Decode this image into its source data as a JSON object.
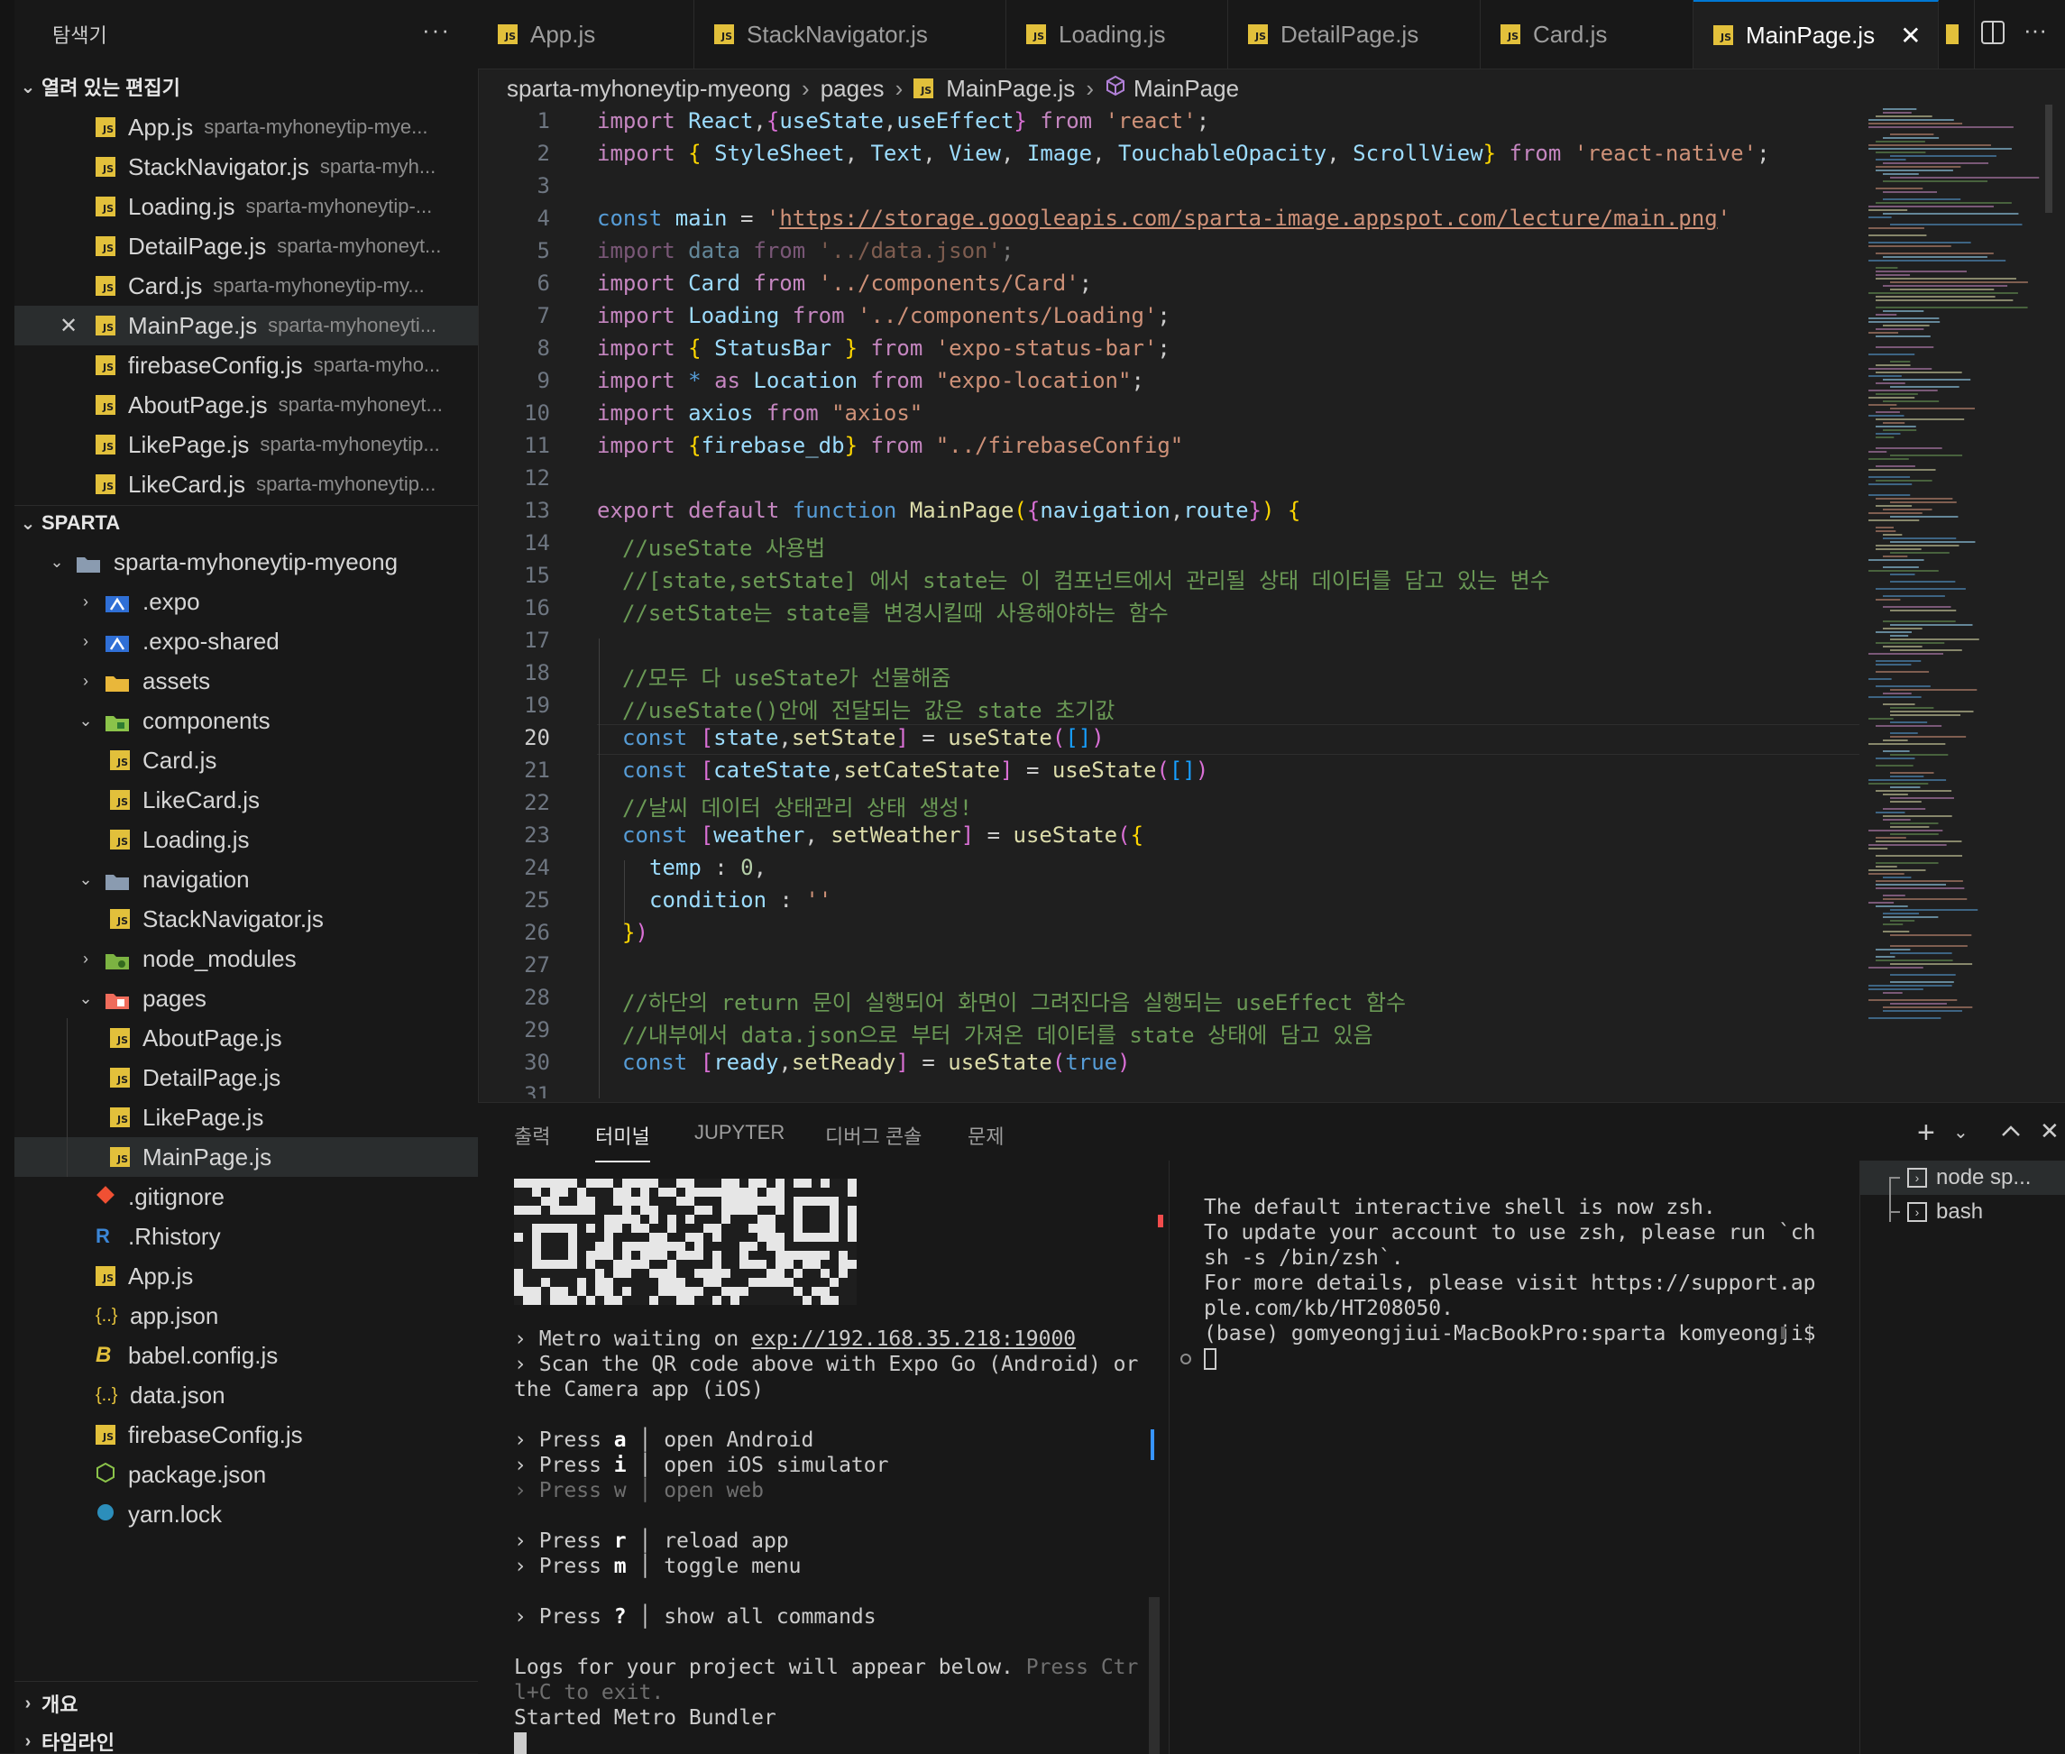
{
  "explorer": {
    "title": "탐색기",
    "more": "···",
    "open_editors_header": "열려 있는 편집기",
    "open_editors": [
      {
        "name": "App.js",
        "desc": "sparta-myhoneytip-mye..."
      },
      {
        "name": "StackNavigator.js",
        "desc": "sparta-myh..."
      },
      {
        "name": "Loading.js",
        "desc": "sparta-myhoneytip-..."
      },
      {
        "name": "DetailPage.js",
        "desc": "sparta-myhoneyt..."
      },
      {
        "name": "Card.js",
        "desc": "sparta-myhoneytip-my..."
      },
      {
        "name": "MainPage.js",
        "desc": "sparta-myhoneyti..."
      },
      {
        "name": "firebaseConfig.js",
        "desc": "sparta-myho..."
      },
      {
        "name": "AboutPage.js",
        "desc": "sparta-myhoneyt..."
      },
      {
        "name": "LikePage.js",
        "desc": "sparta-myhoneytip..."
      },
      {
        "name": "LikeCard.js",
        "desc": "sparta-myhoneytip..."
      }
    ],
    "project_header": "SPARTA",
    "tree": {
      "root": "sparta-myhoneytip-myeong",
      "expo": ".expo",
      "expo_shared": ".expo-shared",
      "assets": "assets",
      "components": "components",
      "card": "Card.js",
      "likecard": "LikeCard.js",
      "loading": "Loading.js",
      "navigation": "navigation",
      "stacknav": "StackNavigator.js",
      "node_modules": "node_modules",
      "pages": "pages",
      "aboutpage": "AboutPage.js",
      "detailpage": "DetailPage.js",
      "likepage": "LikePage.js",
      "mainpage": "MainPage.js",
      "gitignore": ".gitignore",
      "rhistory": ".Rhistory",
      "appjs": "App.js",
      "appjson": "app.json",
      "babel": "babel.config.js",
      "datajson": "data.json",
      "firebase": "firebaseConfig.js",
      "packagejson": "package.json",
      "yarnlock": "yarn.lock"
    },
    "outline_header": "개요",
    "timeline_header": "타임라인"
  },
  "tabs": [
    "App.js",
    "StackNavigator.js",
    "Loading.js",
    "DetailPage.js",
    "Card.js",
    "MainPage.js"
  ],
  "breadcrumb": {
    "folder": "sparta-myhoneytip-myeong",
    "sub": "pages",
    "file": "MainPage.js",
    "symbol": "MainPage"
  },
  "editor": {
    "current_line": 20,
    "line_numbers": [
      "1",
      "2",
      "3",
      "4",
      "5",
      "6",
      "7",
      "8",
      "9",
      "10",
      "11",
      "12",
      "13",
      "14",
      "15",
      "16",
      "17",
      "18",
      "19",
      "20",
      "21",
      "22",
      "23",
      "24",
      "25",
      "26",
      "27",
      "28",
      "29",
      "30",
      "31"
    ],
    "c14": "//useState 사용법",
    "c15": "//[state,setState] 에서 state는 이 컴포넌트에서 관리될 상태 데이터를 담고 있는 변수",
    "c16": "//setState는 state를 변경시킬때 사용해야하는 함수",
    "c18": "//모두 다 useState가 선물해줌",
    "c19": "//useState()안에 전달되는 값은 state 초기값",
    "c22": "//날씨 데이터 상태관리 상태 생성!",
    "c28": "//하단의 return 문이 실행되어 화면이 그려진다음 실행되는 useEffect 함수",
    "c29": "//내부에서 data.json으로 부터 가져온 데이터를 state 상태에 담고 있음",
    "url": "https://storage.googleapis.com/sparta-image.appspot.com/lecture/main.png"
  },
  "panel": {
    "tabs": [
      "출력",
      "터미널",
      "JUPYTER",
      "디버그 콘솔",
      "문제"
    ],
    "active_tab": "터미널",
    "left_terminal": {
      "metro_prefix": "› Metro waiting on ",
      "metro_url": "exp://192.168.35.218:19000",
      "scan1": "› Scan the QR code above with Expo Go (Android) or",
      "scan2": "the Camera app (iOS)",
      "cmds": [
        {
          "key": "a",
          "label": "open Android",
          "dim": false
        },
        {
          "key": "i",
          "label": "open iOS simulator",
          "dim": false
        },
        {
          "key": "w",
          "label": "open web",
          "dim": true
        },
        {
          "key": "r",
          "label": "reload app",
          "dim": false
        },
        {
          "key": "m",
          "label": "toggle menu",
          "dim": false
        },
        {
          "key": "?",
          "label": "show all commands",
          "dim": false
        }
      ],
      "press": "› Press",
      "logs1": "Logs for your project will appear below.",
      "logs1b": " Press Ctr",
      "logs2": "l+C to exit.",
      "started": "Started Metro Bundler"
    },
    "right_terminal": [
      "The default interactive shell is now zsh.",
      "To update your account to use zsh, please run `ch",
      "sh -s /bin/zsh`.",
      "For more details, please visit https://support.ap",
      "ple.com/kb/HT208050.",
      "(base) gomyeongjiui-MacBookPro:sparta komyeongji$"
    ],
    "terminals": [
      "node sp...",
      "bash"
    ]
  }
}
